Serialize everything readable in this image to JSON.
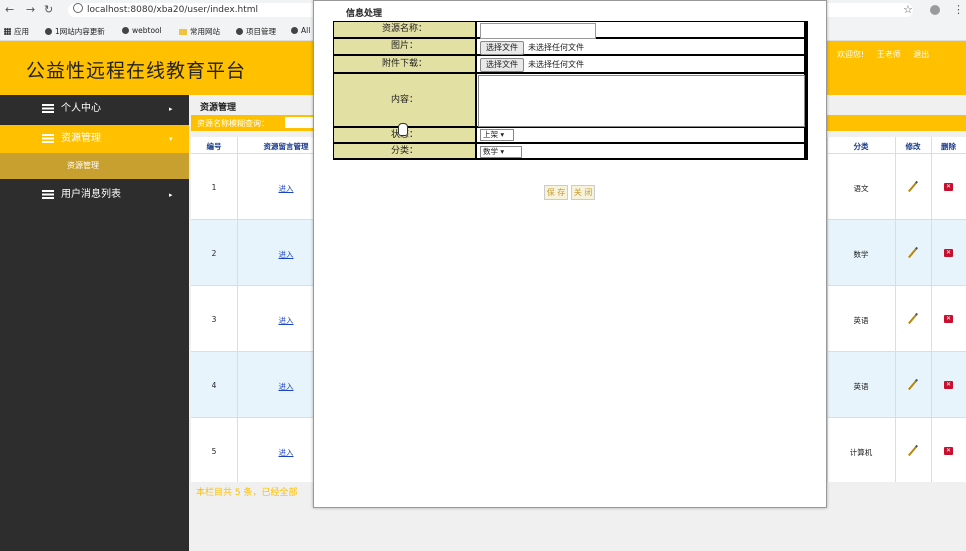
{
  "browser": {
    "url": "localhost:8080/xba20/user/index.html",
    "bookmarks": [
      "应用",
      "1网站内容更新",
      "webtool",
      "常用网站",
      "项目管理",
      "All"
    ]
  },
  "header": {
    "title": "公益性远程在线教育平台",
    "links": [
      "欢迎您!",
      "王老师",
      "退出"
    ]
  },
  "sidebar": {
    "items": [
      {
        "label": "个人中心",
        "arrow": "▸"
      },
      {
        "label": "资源管理",
        "arrow": "▾"
      },
      {
        "label": "用户消息列表",
        "arrow": "▸"
      }
    ],
    "sub_item": "资源管理"
  },
  "main": {
    "breadcrumb": "资源管理",
    "search_label": "资源名称模糊查询：",
    "columns": {
      "id": "编号",
      "manage": "资源留言管理",
      "category": "分类",
      "edit": "修改",
      "delete": "删除"
    },
    "rows": [
      {
        "id": "1",
        "link": "进入",
        "category": "语文"
      },
      {
        "id": "2",
        "link": "进入",
        "category": "数学"
      },
      {
        "id": "3",
        "link": "进入",
        "category": "英语"
      },
      {
        "id": "4",
        "link": "进入",
        "category": "英语"
      },
      {
        "id": "5",
        "link": "进入",
        "category": "计算机"
      }
    ],
    "footer": "本栏目共 5 条，已经全部"
  },
  "modal": {
    "title": "信息处理",
    "fields": {
      "name": "资源名称：",
      "image": "图片：",
      "attachment": "附件下载：",
      "content": "内容：",
      "status": "状态：",
      "category": "分类："
    },
    "file_button": "选择文件",
    "file_none": "未选择任何文件",
    "status_value": "上架 ▾",
    "category_value": "数学 ▾",
    "save": "保 存",
    "close": "关 闭"
  }
}
